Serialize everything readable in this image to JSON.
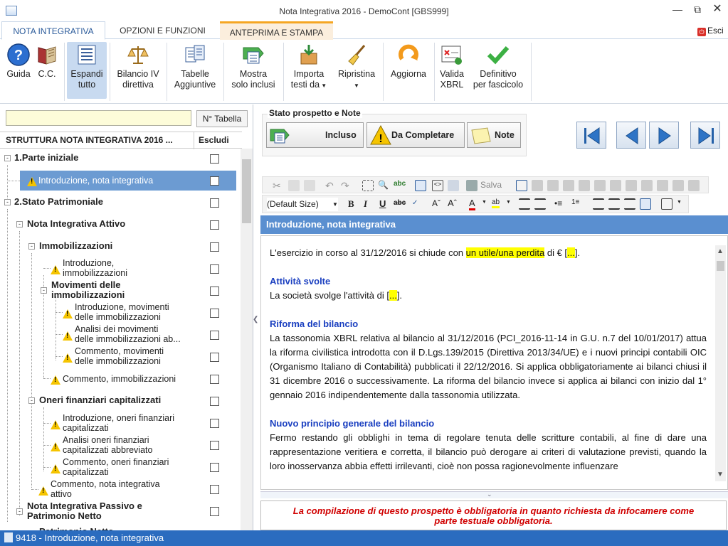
{
  "window": {
    "title": "Nota Integrativa 2016 - DemoCont [GBS999]",
    "controls": [
      "minimize-icon",
      "restore-icon",
      "close-icon"
    ]
  },
  "tabs": [
    {
      "label": "NOTA INTEGRATIVA",
      "active": true
    },
    {
      "label": "OPZIONI E FUNZIONI",
      "active": false
    },
    {
      "label": "ANTEPRIMA E STAMPA",
      "active": false
    }
  ],
  "esci": "Esci",
  "ribbon": [
    {
      "line1": "Guida",
      "line2": "",
      "icon": "help-icon"
    },
    {
      "line1": "C.C.",
      "line2": "",
      "icon": "book-icon"
    },
    {
      "line1": "Espandi",
      "line2": "tutto",
      "icon": "expand-list-icon",
      "active": true
    },
    {
      "line1": "Bilancio IV",
      "line2": "direttiva",
      "icon": "scales-icon"
    },
    {
      "line1": "Tabelle",
      "line2": "Aggiuntive",
      "icon": "tables-icon"
    },
    {
      "line1": "Mostra",
      "line2": "solo inclusi",
      "icon": "arrow-list-icon"
    },
    {
      "line1": "Importa",
      "line2": "testi da",
      "icon": "import-box-icon",
      "dropdown": true
    },
    {
      "line1": "Ripristina",
      "line2": "",
      "icon": "broom-icon",
      "dropdown": true
    },
    {
      "line1": "Aggiorna",
      "line2": "",
      "icon": "refresh-icon"
    },
    {
      "line1": "Valida",
      "line2": "XBRL",
      "icon": "xbrl-validate-icon"
    },
    {
      "line1": "Definitivo",
      "line2": "per fascicolo",
      "icon": "checkmark-icon"
    }
  ],
  "left": {
    "search_value": "",
    "ntabella": "N° Tabella",
    "tree_header": "STRUTTURA NOTA INTEGRATIVA 2016 ...",
    "escludi": "Escludi",
    "nodes": [
      {
        "l1": "1.Parte iniziale",
        "l2": "",
        "bold": true,
        "warn": false
      },
      {
        "l1": "Introduzione, nota integrativa",
        "l2": "",
        "bold": false,
        "warn": true,
        "selected": true
      },
      {
        "l1": "2.Stato Patrimoniale",
        "l2": "",
        "bold": true,
        "warn": false
      },
      {
        "l1": "Nota Integrativa Attivo",
        "l2": "",
        "bold": true,
        "warn": false
      },
      {
        "l1": "Immobilizzazioni",
        "l2": "",
        "bold": true,
        "warn": false
      },
      {
        "l1": "Introduzione,",
        "l2": "immobilizzazioni",
        "bold": false,
        "warn": true
      },
      {
        "l1": "Movimenti delle",
        "l2": "immobilizzazioni",
        "bold": true,
        "warn": false
      },
      {
        "l1": "Introduzione, movimenti",
        "l2": "delle immobilizzazioni",
        "bold": false,
        "warn": true
      },
      {
        "l1": "Analisi dei movimenti",
        "l2": "delle immobilizzazioni ab...",
        "bold": false,
        "warn": true
      },
      {
        "l1": "Commento, movimenti",
        "l2": "delle immobilizzazioni",
        "bold": false,
        "warn": true
      },
      {
        "l1": "Commento, immobilizzazioni",
        "l2": "",
        "bold": false,
        "warn": true
      },
      {
        "l1": "Oneri finanziari capitalizzati",
        "l2": "",
        "bold": true,
        "warn": false
      },
      {
        "l1": "Introduzione, oneri finanziari",
        "l2": "capitalizzati",
        "bold": false,
        "warn": true
      },
      {
        "l1": "Analisi oneri finanziari",
        "l2": "capitalizzati abbreviato",
        "bold": false,
        "warn": true
      },
      {
        "l1": "Commento, oneri finanziari",
        "l2": "capitalizzati",
        "bold": false,
        "warn": true
      },
      {
        "l1": "Commento, nota integrativa",
        "l2": "attivo",
        "bold": false,
        "warn": true
      },
      {
        "l1": "Nota Integrativa Passivo e",
        "l2": "Patrimonio Netto",
        "bold": true,
        "warn": false
      },
      {
        "l1": "Patrimonio Netto",
        "l2": "",
        "bold": true,
        "warn": false
      }
    ]
  },
  "stato": {
    "title": "Stato prospetto e Note",
    "incluso": "Incluso",
    "da_completare": "Da Completare",
    "note": "Note"
  },
  "toolbar": {
    "salva": "Salva",
    "font_size": "(Default Size)"
  },
  "editor": {
    "header": "Introduzione, nota integrativa",
    "p1_a": "L'esercizio in corso al 31/12/2016 si chiude con ",
    "p1_hl": "un utile/una perdita",
    "p1_b": " di € [",
    "p1_hl2": "...",
    "p1_c": "].",
    "h1": "Attività svolte",
    "p2_a": "La società svolge l'attività di [",
    "p2_hl": "...",
    "p2_b": "].",
    "h2": "Riforma del bilancio",
    "p3": "La tassonomia XBRL relativa al bilancio al 31/12/2016 (PCI_2016-11-14 in G.U. n.7 del 10/01/2017) attua la riforma civilistica introdotta con il D.Lgs.139/2015 (Direttiva 2013/34/UE) e i nuovi principi contabili OIC (Organismo Italiano di Contabilità) pubblicati il 22/12/2016. Si applica obbligatoriamente ai bilanci chiusi il 31 dicembre 2016 o successivamente. La riforma del bilancio invece si applica ai bilanci con inizio dal 1° gennaio 2016 indipendentemente dalla tassonomia utilizzata.",
    "h3": "Nuovo principio generale del bilancio",
    "p4": "Fermo restando gli obblighi in tema di regolare tenuta delle scritture contabili, al fine di dare una rappresentazione veritiera e corretta, il bilancio può derogare ai criteri di valutazione previsti, quando la loro inosservanza abbia effetti irrilevanti, cioè non possa ragionevolmente influenzare"
  },
  "notebox": {
    "line1": "La compilazione di questo prospetto è obbligatoria in quanto richiesta da infocamere come",
    "line2": "parte testuale obbligatoria."
  },
  "status": "9418 - Introduzione, nota integrativa",
  "colors": {
    "accent": "#2b6cbf",
    "selection": "#6c9bd2",
    "warning": "#f5c400",
    "tab_highlight": "#f5a623"
  }
}
